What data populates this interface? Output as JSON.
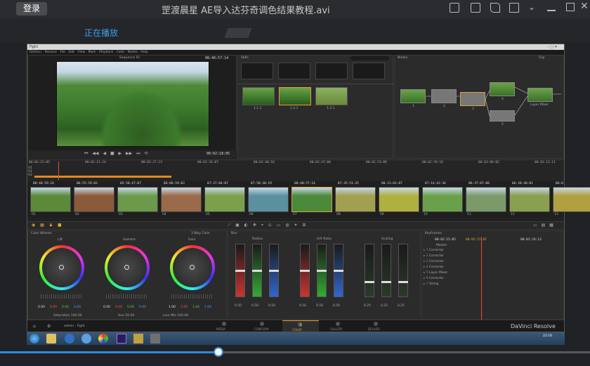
{
  "player": {
    "login_label": "登录",
    "video_title": "罡渡晨星 AE导入达芬奇调色结果教程.avi",
    "tab_playing": "正在播放",
    "progress_fraction": 0.37
  },
  "resolve": {
    "window_title": "Fight",
    "menu": "DaVinci Resolve File Edit View Mark Playback Color Nodes Help",
    "viewer": {
      "clip_label": "Sequence 01",
      "timecode_top": "08:40:57:14",
      "timecode_transport": "00:02:18:05"
    },
    "gallery": {
      "label": "Stills",
      "search_placeholder": "Search",
      "stills": [
        "1.1.1",
        "1.2.1",
        "1.3.1"
      ]
    },
    "nodes": {
      "label": "Nodes",
      "mode": "Clip",
      "node_labels": [
        "1",
        "2",
        "3",
        "4",
        "5"
      ],
      "layer_mixer": "Layer Mixer"
    },
    "timeline_ruler": [
      "00:02:15:05",
      "00:02:21:14",
      "00:02:27:23",
      "00:02:34:07",
      "00:02:40:16",
      "00:02:47:00",
      "00:02:53:09",
      "00:02:59:18",
      "00:03:06:02",
      "00:03:12:11"
    ],
    "tracks": [
      "V1",
      "A1",
      "A2"
    ],
    "clips": [
      {
        "tc": "08:48:59:24",
        "num": "01",
        "color": "#5a8a3a"
      },
      {
        "tc": "06:55:59:03",
        "num": "02",
        "color": "#8a5a3a"
      },
      {
        "tc": "05:58:47:07",
        "num": "03",
        "color": "#6a9a4a"
      },
      {
        "tc": "06:06:59:03",
        "num": "04",
        "color": "#9a6a4a"
      },
      {
        "tc": "07:37:04:07",
        "num": "05",
        "color": "#7aa04a"
      },
      {
        "tc": "07:50:30:19",
        "num": "06",
        "color": "#5a90a0"
      },
      {
        "tc": "08:40:57:14",
        "num": "07",
        "color": "#4a8a3a"
      },
      {
        "tc": "07:35:51:35",
        "num": "08",
        "color": "#a0a050"
      },
      {
        "tc": "08:31:01:07",
        "num": "09",
        "color": "#b0b040"
      },
      {
        "tc": "07:14:42:36",
        "num": "10",
        "color": "#6aa04a"
      },
      {
        "tc": "06:37:07:08",
        "num": "11",
        "color": "#7a9a6a"
      },
      {
        "tc": "06:38:40:01",
        "num": "12",
        "color": "#8aa050"
      },
      {
        "tc": "06:0",
        "num": "13",
        "color": "#b0a040"
      }
    ],
    "color_wheels": {
      "label": "Color Wheels",
      "mode": "3 Way Color",
      "wheels": [
        {
          "name": "Lift",
          "values": [
            "0.00",
            "0.00",
            "0.00",
            "0.00"
          ]
        },
        {
          "name": "Gamma",
          "values": [
            "0.00",
            "0.00",
            "0.00",
            "0.00"
          ]
        },
        {
          "name": "Gain",
          "values": [
            "1.00",
            "1.00",
            "1.00",
            "1.00"
          ]
        }
      ],
      "saturation": "Saturation 100.00",
      "hue": "Hue 50.00",
      "lum_mix": "Lum Mix 100.00"
    },
    "curves": {
      "label": "Blur",
      "sections": [
        {
          "name": "Radius",
          "values": [
            "0.50",
            "0.50",
            "0.50"
          ]
        },
        {
          "name": "H/V Ratio",
          "values": [
            "0.50",
            "0.50",
            "0.50"
          ]
        },
        {
          "name": "Scaling",
          "values": [
            "0.25",
            "0.25",
            "0.25"
          ]
        }
      ]
    },
    "keyframes": {
      "label": "Keyframes",
      "tc_left": "00:02:15:05",
      "tc_right": "00:02:24:13",
      "master": "Master",
      "items": [
        "Corrector",
        "Corrector",
        "Corrector",
        "Corrector",
        "Layer Mixer",
        "Corrector",
        "Sizing"
      ]
    },
    "bottom_tabs": [
      "MEDIA",
      "CONFORM",
      "COLOR",
      "GALLERY",
      "DELIVER"
    ],
    "active_tab": "COLOR",
    "project": "admin - Fight",
    "brand": "DaVinci Resolve",
    "clock": "22:16"
  }
}
